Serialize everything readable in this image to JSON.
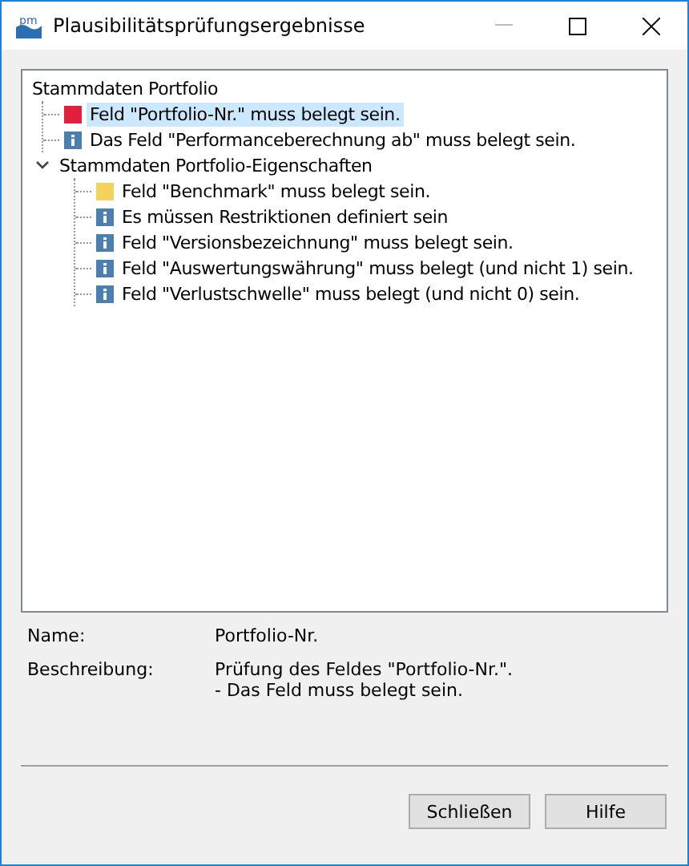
{
  "window": {
    "logo": "pm",
    "title": "Plausibilitätsprüfungsergebnisse"
  },
  "tree": [
    {
      "label": "Stammdaten Portfolio",
      "children": [
        {
          "label": "Feld \"Portfolio-Nr.\" muss belegt sein.",
          "kind": "error",
          "selected": true
        },
        {
          "label": "Das Feld \"Performanceberechnung ab\" muss belegt sein.",
          "kind": "info",
          "selected": false
        }
      ]
    },
    {
      "label": "Stammdaten Portfolio-Eigenschaften",
      "expanded": true,
      "children": [
        {
          "label": "Feld \"Benchmark\" muss belegt sein.",
          "kind": "warning",
          "selected": false
        },
        {
          "label": "Es müssen Restriktionen definiert sein",
          "kind": "info",
          "selected": false
        },
        {
          "label": "Feld \"Versionsbezeichnung\" muss belegt sein.",
          "kind": "info",
          "selected": false
        },
        {
          "label": "Feld \"Auswertungswährung\" muss belegt (und nicht 1) sein.",
          "kind": "info",
          "selected": false
        },
        {
          "label": "Feld \"Verlustschwelle\" muss belegt (und nicht 0) sein.",
          "kind": "info",
          "selected": false
        }
      ]
    }
  ],
  "details": [
    {
      "label": "Name:",
      "value": "Portfolio-Nr."
    },
    {
      "label": "Beschreibung:",
      "value": "Prüfung des Feldes \"Portfolio-Nr.\".\n- Das Feld muss belegt sein."
    }
  ],
  "buttons": [
    "Schließen",
    "Hilfe"
  ]
}
